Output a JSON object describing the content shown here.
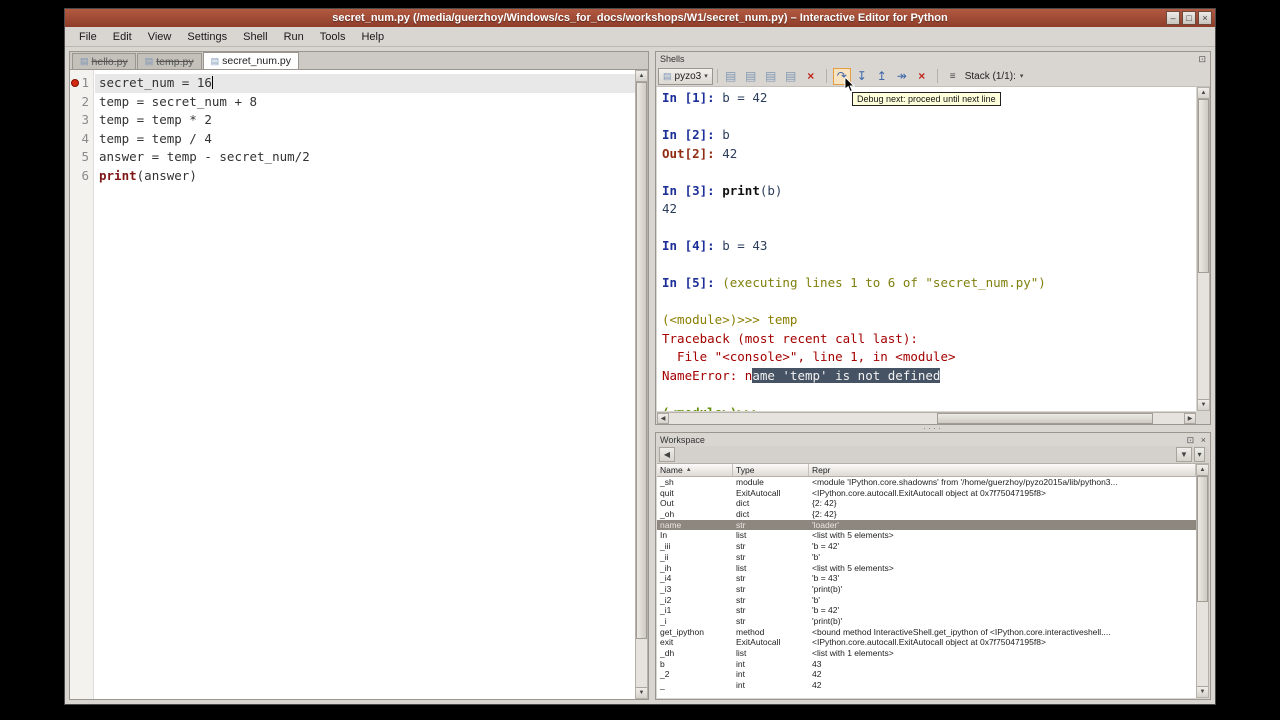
{
  "window": {
    "title": "secret_num.py (/media/guerzhoy/Windows/cs_for_docs/workshops/W1/secret_num.py) – Interactive Editor for Python",
    "buttons": [
      {
        "name": "minimize-button",
        "glyph": "–"
      },
      {
        "name": "maximize-button",
        "glyph": "□"
      },
      {
        "name": "close-button",
        "glyph": "×"
      }
    ]
  },
  "menu": {
    "items": [
      "File",
      "Edit",
      "View",
      "Settings",
      "Shell",
      "Run",
      "Tools",
      "Help"
    ]
  },
  "icons": {
    "page": "▤",
    "dropdown": "▾",
    "back": "◀",
    "sort_asc": "▲",
    "float": "⊡",
    "close": "×",
    "funnel": "▼",
    "scroll_up": "▲",
    "scroll_down": "▼",
    "scroll_left": "◀",
    "scroll_right": "▶"
  },
  "editor": {
    "tabs": [
      {
        "label": "hello.py",
        "active": false,
        "struck": true
      },
      {
        "label": "temp.py",
        "active": false,
        "struck": true
      },
      {
        "label": "secret_num.py",
        "active": true,
        "struck": false
      }
    ],
    "lines": [
      {
        "num": "1",
        "segments": [
          {
            "t": "secret_num = 16",
            "c": "plain"
          }
        ],
        "highlight": true,
        "breakpoint": true,
        "caret": true
      },
      {
        "num": "2",
        "segments": [
          {
            "t": "temp = secret_num + 8",
            "c": "plain"
          }
        ]
      },
      {
        "num": "3",
        "segments": [
          {
            "t": "temp = temp * 2",
            "c": "plain"
          }
        ]
      },
      {
        "num": "4",
        "segments": [
          {
            "t": "temp = temp / 4",
            "c": "plain"
          }
        ]
      },
      {
        "num": "5",
        "segments": [
          {
            "t": "answer = temp - secret_num/2",
            "c": "plain"
          }
        ]
      },
      {
        "num": "6",
        "segments": [
          {
            "t": "print",
            "c": "kw"
          },
          {
            "t": "(answer)",
            "c": "plain"
          }
        ]
      }
    ]
  },
  "shells": {
    "panel_title": "Shells",
    "shell_tab": "pyzo3",
    "stack_label": "Stack (1/1):",
    "tooltip": "Debug next: proceed until next line",
    "toolbar_icons": [
      {
        "name": "edit-shell-config-icon",
        "glyph": "▤",
        "cls": "doc"
      },
      {
        "name": "new-shell-icon",
        "glyph": "▤",
        "cls": "doc"
      },
      {
        "name": "clear-screen-icon",
        "glyph": "▤",
        "cls": "doc"
      },
      {
        "name": "restart-shell-icon",
        "glyph": "▤",
        "cls": "doc"
      },
      {
        "name": "terminate-shell-icon",
        "glyph": "×",
        "cls": "red"
      },
      {
        "sep": true
      },
      {
        "name": "debug-next-icon",
        "glyph": "↷",
        "cls": "blue",
        "hl": true
      },
      {
        "name": "debug-step-into-icon",
        "glyph": "↧",
        "cls": "blue"
      },
      {
        "name": "debug-return-icon",
        "glyph": "↥",
        "cls": "blue"
      },
      {
        "name": "debug-continue-icon",
        "glyph": "↠",
        "cls": "blue"
      },
      {
        "name": "debug-stop-icon",
        "glyph": "×",
        "cls": "red"
      },
      {
        "sep": true
      },
      {
        "name": "stack-list-icon",
        "glyph": "≡",
        "cls": "dark"
      }
    ],
    "lines": [
      {
        "segments": [
          {
            "t": "In [1]: ",
            "c": "in"
          },
          {
            "t": "b = 42",
            "c": "code"
          }
        ]
      },
      {
        "segments": []
      },
      {
        "segments": [
          {
            "t": "In [2]: ",
            "c": "in"
          },
          {
            "t": "b",
            "c": "code"
          }
        ]
      },
      {
        "segments": [
          {
            "t": "Out[2]: ",
            "c": "out"
          },
          {
            "t": "42",
            "c": "code"
          }
        ]
      },
      {
        "segments": []
      },
      {
        "segments": [
          {
            "t": "In [3]: ",
            "c": "in"
          },
          {
            "t": "print",
            "c": "kwsh"
          },
          {
            "t": "(b)",
            "c": "code"
          }
        ]
      },
      {
        "segments": [
          {
            "t": "42",
            "c": "code"
          }
        ]
      },
      {
        "segments": []
      },
      {
        "segments": [
          {
            "t": "In [4]: ",
            "c": "in"
          },
          {
            "t": "b = 43",
            "c": "code"
          }
        ]
      },
      {
        "segments": []
      },
      {
        "segments": [
          {
            "t": "In [5]: ",
            "c": "in"
          },
          {
            "t": "(executing lines 1 to 6 of \"secret_num.py\")",
            "c": "exec"
          }
        ]
      },
      {
        "segments": []
      },
      {
        "segments": [
          {
            "t": "(<module>)>>> temp",
            "c": "mod"
          }
        ]
      },
      {
        "segments": [
          {
            "t": "Traceback (most recent call last):",
            "c": "err"
          }
        ]
      },
      {
        "segments": [
          {
            "t": "  File \"<console>\", line 1, in <module>",
            "c": "err"
          }
        ]
      },
      {
        "segments": [
          {
            "t": "NameError: n",
            "c": "err"
          },
          {
            "t": "ame 'temp' is not defined",
            "c": "errsel"
          }
        ]
      },
      {
        "segments": []
      },
      {
        "segments": [
          {
            "t": "(<module>)>>>",
            "c": "mod2"
          }
        ]
      }
    ]
  },
  "workspace": {
    "panel_title": "Workspace",
    "columns": [
      {
        "label": "Name"
      },
      {
        "label": "Type"
      },
      {
        "label": "Repr"
      }
    ],
    "rows": [
      {
        "name": "_sh",
        "type": "module",
        "repr": "<module 'IPython.core.shadowns' from '/home/guerzhoy/pyzo2015a/lib/python3..."
      },
      {
        "name": "quit",
        "type": "ExitAutocall",
        "repr": "<IPython.core.autocall.ExitAutocall object at 0x7f75047195f8>"
      },
      {
        "name": "Out",
        "type": "dict",
        "repr": "{2: 42}"
      },
      {
        "name": "_oh",
        "type": "dict",
        "repr": "{2: 42}"
      },
      {
        "name": "name",
        "type": "str",
        "repr": "'loader'",
        "sel": true
      },
      {
        "name": "In",
        "type": "list",
        "repr": "<list with 5 elements>"
      },
      {
        "name": "_iii",
        "type": "str",
        "repr": "'b = 42'"
      },
      {
        "name": "_ii",
        "type": "str",
        "repr": "'b'"
      },
      {
        "name": "_ih",
        "type": "list",
        "repr": "<list with 5 elements>"
      },
      {
        "name": "_i4",
        "type": "str",
        "repr": "'b = 43'"
      },
      {
        "name": "_i3",
        "type": "str",
        "repr": "'print(b)'"
      },
      {
        "name": "_i2",
        "type": "str",
        "repr": "'b'"
      },
      {
        "name": "_i1",
        "type": "str",
        "repr": "'b = 42'"
      },
      {
        "name": "_i",
        "type": "str",
        "repr": "'print(b)'"
      },
      {
        "name": "get_ipython",
        "type": "method",
        "repr": "<bound method InteractiveShell.get_ipython of <IPython.core.interactiveshell...."
      },
      {
        "name": "exit",
        "type": "ExitAutocall",
        "repr": "<IPython.core.autocall.ExitAutocall object at 0x7f75047195f8>"
      },
      {
        "name": "_dh",
        "type": "list",
        "repr": "<list with 1 elements>"
      },
      {
        "name": "b",
        "type": "int",
        "repr": "43"
      },
      {
        "name": "_2",
        "type": "int",
        "repr": "42"
      },
      {
        "name": "_",
        "type": "int",
        "repr": "42"
      }
    ]
  }
}
